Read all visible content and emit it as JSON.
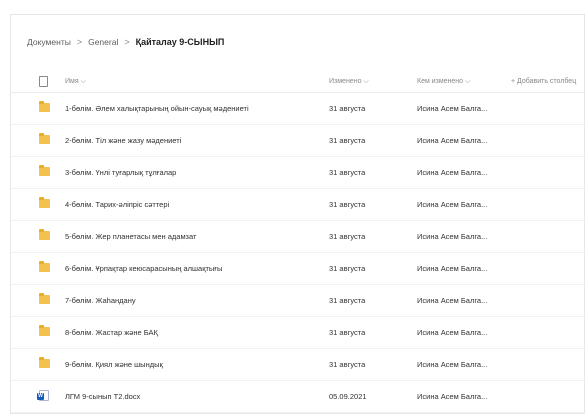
{
  "breadcrumb": {
    "items": [
      "Документы",
      "General"
    ],
    "current": "Қайталау 9-СЫНЫП"
  },
  "header": {
    "name": "Имя",
    "modified": "Изменено",
    "modified_by": "Кем изменено",
    "add_column": "+ Добавить столбец"
  },
  "icons": {
    "folder": "folder-icon",
    "word": "word-document-icon",
    "file_type": "file-type-icon",
    "chevron": "chevron-down-icon"
  },
  "rows": [
    {
      "type": "folder",
      "name": "1-бөлім. Әлем халықтарының ойын-сауық мәдениеті",
      "modified": "31 августа",
      "modified_by": "Исина Асем Балга..."
    },
    {
      "type": "folder",
      "name": "2-бөлім. Тіл және жазу мәдениеті",
      "modified": "31 августа",
      "modified_by": "Исина Асем Балга..."
    },
    {
      "type": "folder",
      "name": "3-бөлім. Үнлі туғарлық тұлғалар",
      "modified": "31 августа",
      "modified_by": "Исина Асем Балга..."
    },
    {
      "type": "folder",
      "name": "4-бөлім. Тарих-әліпріс сәттері",
      "modified": "31 августа",
      "modified_by": "Исина Асем Балга..."
    },
    {
      "type": "folder",
      "name": "5-бөлім. Жер планетасы мен адамзат",
      "modified": "31 августа",
      "modified_by": "Исина Асем Балга..."
    },
    {
      "type": "folder",
      "name": "6-бөлім. Ұрпақтар кеюсарасының алшақтығы",
      "modified": "31 августа",
      "modified_by": "Исина Асем Балга..."
    },
    {
      "type": "folder",
      "name": "7-бөлім. Жаһандану",
      "modified": "31 августа",
      "modified_by": "Исина Асем Балга..."
    },
    {
      "type": "folder",
      "name": "8-бөлім. Жастар және БАҚ",
      "modified": "31 августа",
      "modified_by": "Исина Асем Балга..."
    },
    {
      "type": "folder",
      "name": "9-бөлім. Қиял және шындық",
      "modified": "31 августа",
      "modified_by": "Исина Асем Балга..."
    },
    {
      "type": "word",
      "name": "ЛГМ 9-сынып Т2.docx",
      "modified": "05.09.2021",
      "modified_by": "Исина Асем Балга..."
    }
  ]
}
